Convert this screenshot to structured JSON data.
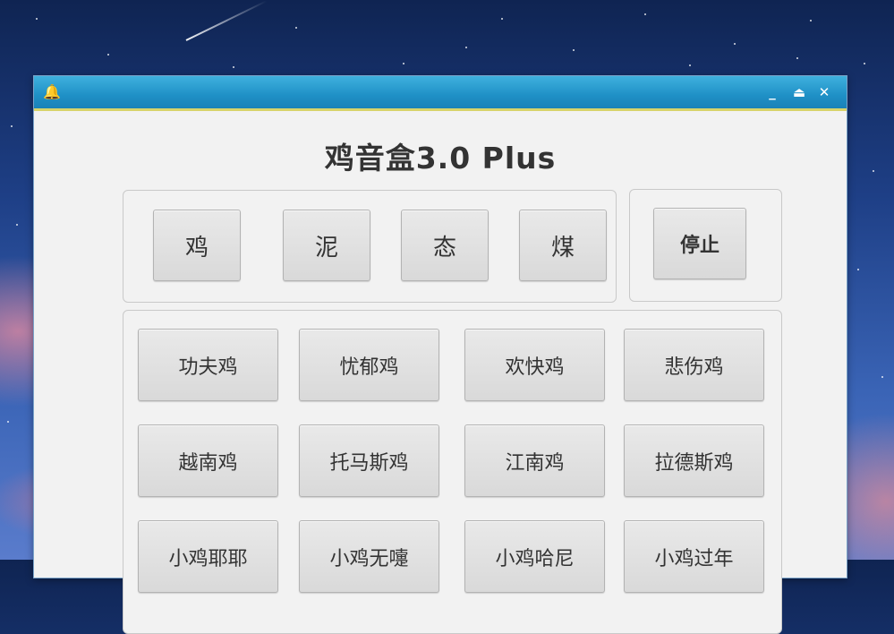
{
  "window": {
    "app_icon": "bell-icon",
    "controls": [
      "_",
      "⏏",
      "✕"
    ]
  },
  "app": {
    "title": "鸡音盒3.0 Plus"
  },
  "top_group": {
    "buttons": [
      "鸡",
      "泥",
      "态",
      "煤"
    ]
  },
  "stop_group": {
    "stop_label": "停止"
  },
  "sound_grid": {
    "rows": [
      [
        "功夫鸡",
        "忧郁鸡",
        "欢快鸡",
        "悲伤鸡"
      ],
      [
        "越南鸡",
        "托马斯鸡",
        "江南鸡",
        "拉德斯鸡"
      ],
      [
        "小鸡耶耶",
        "小鸡无嚏",
        "小鸡哈尼",
        "小鸡过年"
      ]
    ]
  },
  "colors": {
    "titlebar": "#1f90c6",
    "window_bg": "#f2f2f2",
    "button_bg": "#dedede"
  }
}
